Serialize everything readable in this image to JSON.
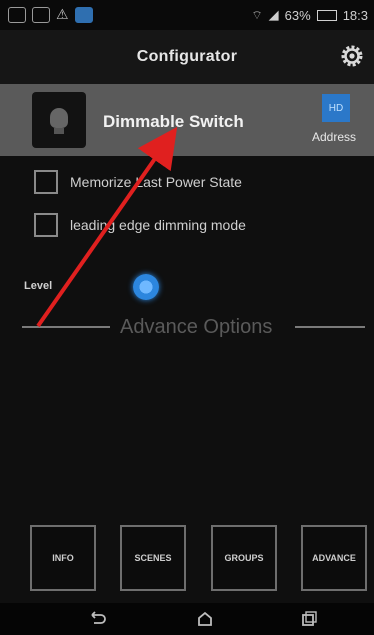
{
  "statusbar": {
    "battery_text": "63%",
    "time": "18:3",
    "icons": [
      "whatsapp-icon",
      "image-icon",
      "warning-icon",
      "app-icon",
      "wifi-icon",
      "signal-icon",
      "battery-icon"
    ]
  },
  "header": {
    "title": "Configurator",
    "settings_icon": "gear-icon"
  },
  "device": {
    "name": "Dimmable Switch",
    "address_badge": "HD",
    "address_label": "Address"
  },
  "options": [
    {
      "label": "Memorize Last Power State",
      "checked": false
    },
    {
      "label": "leading edge dimming mode",
      "checked": false
    }
  ],
  "level": {
    "label": "Level",
    "value_fraction": 0.25
  },
  "advanced": {
    "title": "Advance Options"
  },
  "bottom_buttons": [
    {
      "label": "INFO"
    },
    {
      "label": "SCENES"
    },
    {
      "label": "GROUPS"
    },
    {
      "label": "ADVANCE"
    }
  ],
  "system_nav": [
    "back-icon",
    "home-icon",
    "recents-icon"
  ],
  "annotation": {
    "color": "#e0201f"
  }
}
